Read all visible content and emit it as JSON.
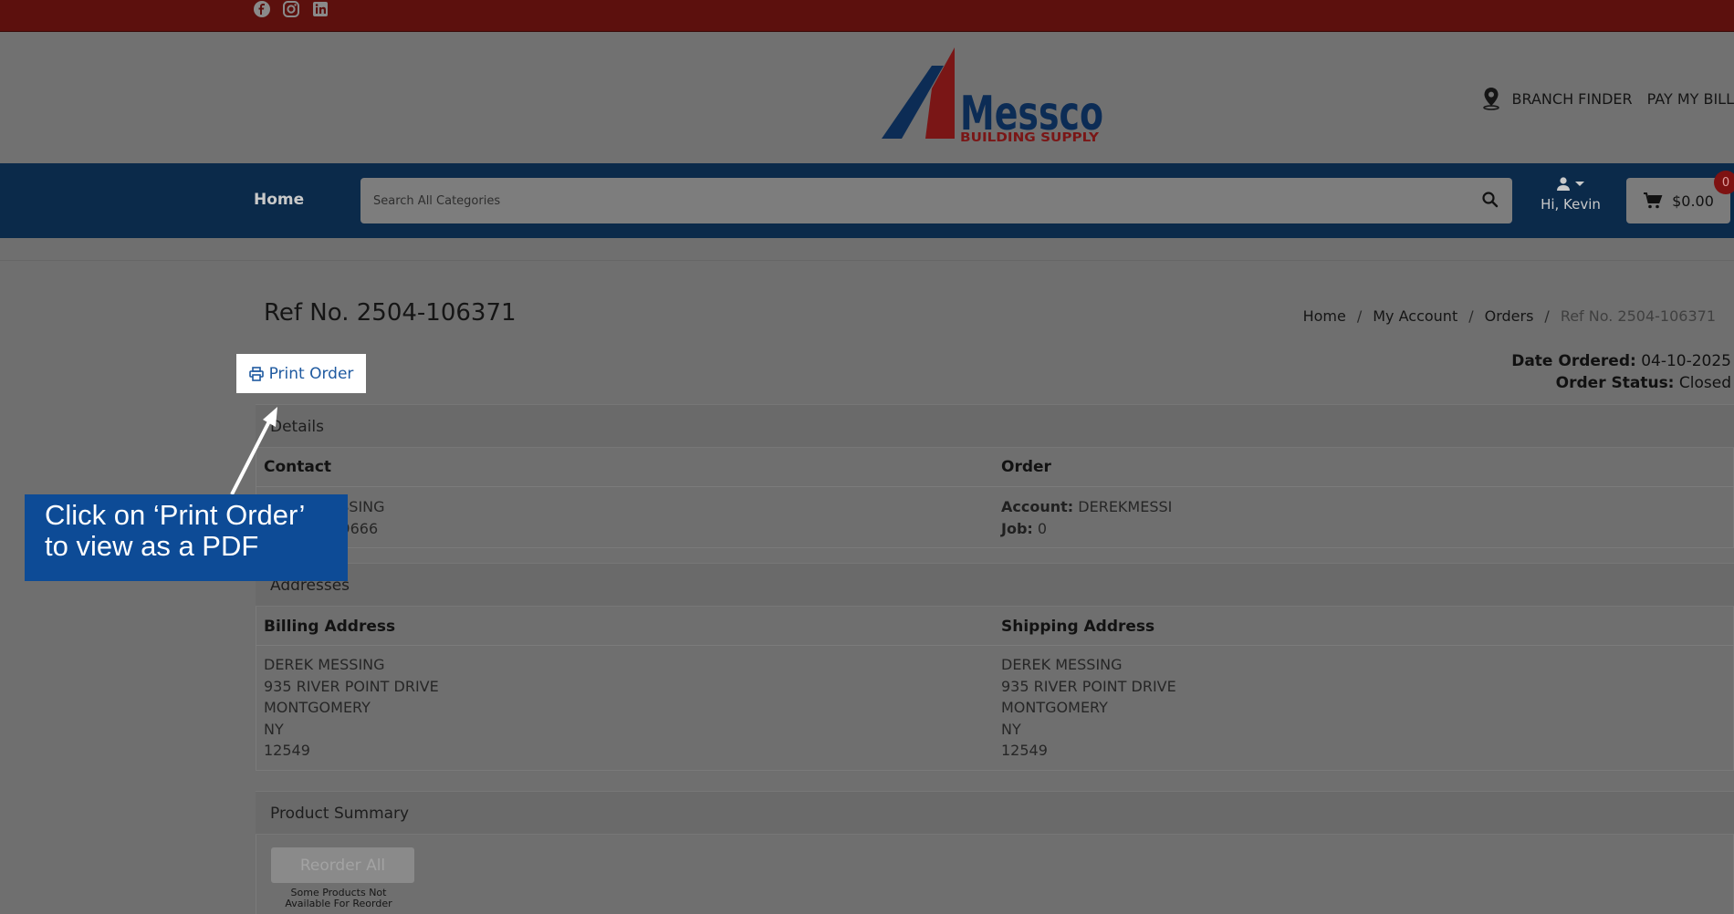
{
  "topbar": {
    "social_icons": [
      "facebook-icon",
      "instagram-icon",
      "linkedin-icon"
    ],
    "color": "#5c100d"
  },
  "header": {
    "logo": {
      "brand": "Messco",
      "tagline": "BUILDING SUPPLY"
    },
    "links": {
      "branch_finder": "BRANCH FINDER",
      "pay_my_bill": "PAY MY BILL"
    }
  },
  "nav": {
    "home": "Home",
    "search_placeholder": "Search All Categories",
    "user_greeting": "Hi, Kevin",
    "cart_total": "$0.00",
    "cart_count": "0",
    "color": "#0b2a4a"
  },
  "page": {
    "title": "Ref No. 2504-106371",
    "breadcrumb": [
      "Home",
      "My Account",
      "Orders",
      "Ref No. 2504-106371"
    ],
    "print_button": "Print Order",
    "date_ordered_label": "Date Ordered:",
    "date_ordered": "04-10-2025",
    "order_status_label": "Order Status:",
    "order_status": "Closed"
  },
  "details": {
    "section_title": "Details",
    "contact_heading": "Contact",
    "contact_name": "DEREK MESSING",
    "contact_phone": "(845) 500-9666",
    "order_heading": "Order",
    "account_label": "Account:",
    "account_value": "DEREKMESSI",
    "job_label": "Job:",
    "job_value": "0"
  },
  "addresses": {
    "section_title": "Addresses",
    "billing_heading": "Billing Address",
    "shipping_heading": "Shipping Address",
    "billing": [
      "DEREK MESSING",
      "935 RIVER POINT DRIVE",
      "MONTGOMERY",
      "NY",
      "12549"
    ],
    "shipping": [
      "DEREK MESSING",
      "935 RIVER POINT DRIVE",
      "MONTGOMERY",
      "NY",
      "12549"
    ]
  },
  "product_summary": {
    "section_title": "Product Summary",
    "reorder_button": "Reorder All",
    "reorder_note": "Some Products Not Available For Reorder"
  },
  "callout": {
    "text_line1": "Click on ‘Print Order’",
    "text_line2": "to view as a PDF",
    "color": "#0d4b96"
  }
}
